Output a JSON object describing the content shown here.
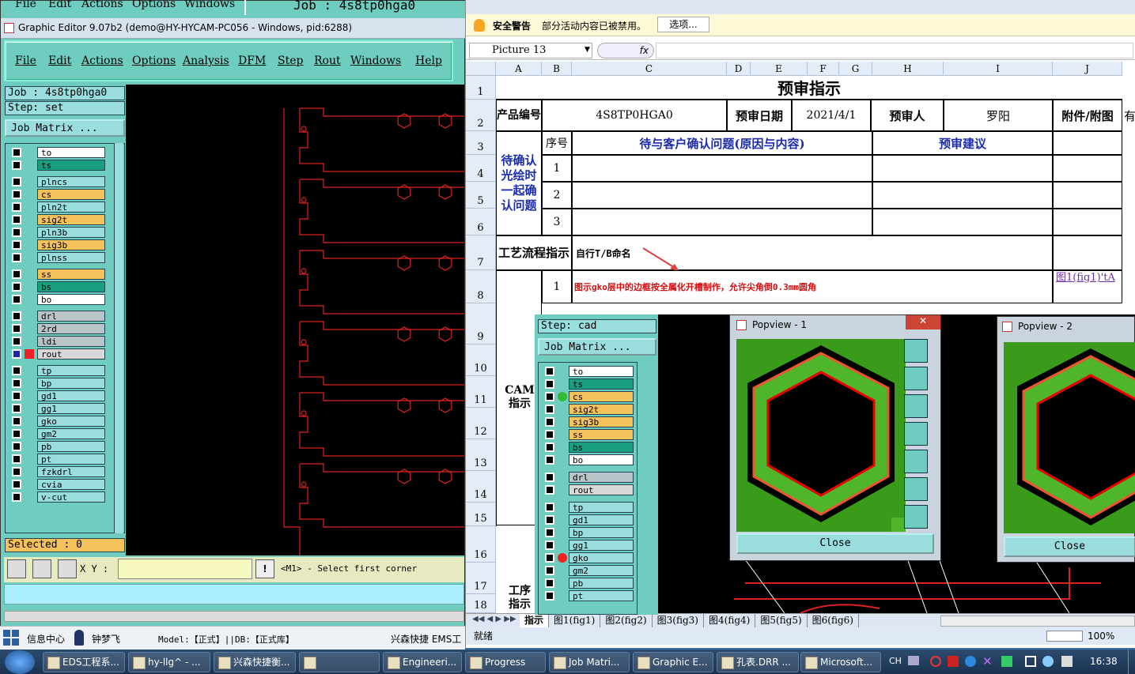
{
  "genesis": {
    "top_menu": [
      "File",
      "Edit",
      "Actions",
      "Options",
      "Windows"
    ],
    "top_job": "Job : 4s8tp0hga0",
    "title": "Graphic Editor 9.07b2 (demo@HY-HYCAM-PC056 - Windows, pid:6288)",
    "menu": [
      "File",
      "Edit",
      "Actions",
      "Options",
      "Analysis",
      "DFM",
      "Step",
      "Rout",
      "Windows",
      "Help"
    ],
    "job_label": "Job : 4s8tp0hga0",
    "step_label": "Step: set",
    "job_matrix": "Job Matrix ...",
    "layers": [
      {
        "name": "to",
        "color": "#ffffff"
      },
      {
        "name": "ts",
        "color": "#1a9e80"
      },
      {
        "name": "plncs",
        "color": "#9dd"
      },
      {
        "name": "cs",
        "color": "#f5c15a"
      },
      {
        "name": "pln2t",
        "color": "#9dd"
      },
      {
        "name": "sig2t",
        "color": "#f5c15a"
      },
      {
        "name": "pln3b",
        "color": "#9dd"
      },
      {
        "name": "sig3b",
        "color": "#f5c15a"
      },
      {
        "name": "plnss",
        "color": "#9dd"
      },
      {
        "name": "ss",
        "color": "#f5c15a"
      },
      {
        "name": "bs",
        "color": "#1a9e80"
      },
      {
        "name": "bo",
        "color": "#ffffff"
      },
      {
        "name": "drl",
        "color": "#b8c4c8"
      },
      {
        "name": "2rd",
        "color": "#b8c4c8"
      },
      {
        "name": "ldi",
        "color": "#b8c4c8"
      },
      {
        "name": "rout",
        "color": "#d8d8d8"
      },
      {
        "name": "tp",
        "color": "#9dd"
      },
      {
        "name": "bp",
        "color": "#9dd"
      },
      {
        "name": "gd1",
        "color": "#9dd"
      },
      {
        "name": "gg1",
        "color": "#9dd"
      },
      {
        "name": "gko",
        "color": "#9dd"
      },
      {
        "name": "gm2",
        "color": "#9dd"
      },
      {
        "name": "pb",
        "color": "#9dd"
      },
      {
        "name": "pt",
        "color": "#9dd"
      },
      {
        "name": "fzkdrl",
        "color": "#9dd"
      },
      {
        "name": "cvia",
        "color": "#9dd"
      },
      {
        "name": "v-cut",
        "color": "#9dd"
      }
    ],
    "selected": "Selected : 0",
    "xy_label": "X Y :",
    "prompt": "<M1> - Select first corner"
  },
  "excel": {
    "security_warning": "安全警告",
    "security_msg": "部分活动内容已被禁用。",
    "options_btn": "选项...",
    "name_box": "Picture 13",
    "fx": "fx",
    "columns": [
      "A",
      "B",
      "C",
      "D",
      "E",
      "F",
      "G",
      "H",
      "I",
      "J"
    ],
    "rows": [
      "1",
      "2",
      "3",
      "4",
      "5",
      "6",
      "7",
      "8",
      "9",
      "10",
      "11",
      "12",
      "13",
      "14",
      "15",
      "16",
      "17",
      "18"
    ],
    "title": "预审指示",
    "r2": {
      "product": "产品编号",
      "code": "4S8TP0HGA0",
      "date_label": "预审日期",
      "date": "2021/4/1",
      "reviewer_label": "预审人",
      "reviewer": "罗阳",
      "attach": "附件/附图",
      "extra": "有"
    },
    "r3": {
      "seq": "序号",
      "issue": "待与客户确认问题(原因与内容)",
      "suggest": "预审建议"
    },
    "side_confirm": "待确认光绘时一起确认问题",
    "nums": [
      "1",
      "2",
      "3"
    ],
    "process_label": "工艺流程指示",
    "process_text": "自行T/B命名",
    "r8_num": "1",
    "r8_text": "图示gko层中的边框按全属化开槽制作，允许尖角倒0.3mm圆角",
    "r8_link": "图1(fig1)'tA",
    "cam_label": "CAM指示",
    "proc_label": "工序指示",
    "sheet_tabs": [
      "指示",
      "图1(fig1)",
      "图2(fig2)",
      "图3(fig3)",
      "图4(fig4)",
      "图5(fig5)",
      "图6(fig6)"
    ],
    "status": "就绪",
    "zoom": "100%"
  },
  "overlay": {
    "step": "Step: cad",
    "job_matrix": "Job Matrix ...",
    "layers": [
      {
        "name": "to",
        "color": "#ffffff"
      },
      {
        "name": "ts",
        "color": "#1a9e80"
      },
      {
        "name": "cs",
        "color": "#f5c15a"
      },
      {
        "name": "sig2t",
        "color": "#f5c15a"
      },
      {
        "name": "sig3b",
        "color": "#f5c15a"
      },
      {
        "name": "ss",
        "color": "#f5c15a"
      },
      {
        "name": "bs",
        "color": "#1a9e80"
      },
      {
        "name": "bo",
        "color": "#ffffff"
      },
      {
        "name": "drl",
        "color": "#b8c4c8"
      },
      {
        "name": "rout",
        "color": "#d8d8d8"
      },
      {
        "name": "tp",
        "color": "#9dd"
      },
      {
        "name": "gd1",
        "color": "#9dd"
      },
      {
        "name": "bp",
        "color": "#9dd"
      },
      {
        "name": "gg1",
        "color": "#9dd"
      },
      {
        "name": "gko",
        "color": "#9dd"
      },
      {
        "name": "gm2",
        "color": "#9dd"
      },
      {
        "name": "pb",
        "color": "#9dd"
      },
      {
        "name": "pt",
        "color": "#9dd"
      }
    ],
    "popview1": "Popview - 1",
    "popview2": "Popview - 2",
    "close": "Close"
  },
  "bottom_bar": {
    "info_center": "信息中心",
    "user": "钟梦飞",
    "model": "Model:【正式】||DB:【正式库】",
    "company": "兴森快捷 EMS工"
  },
  "taskbar": {
    "items": [
      "EDS工程系...",
      "hy-llg^ - ...",
      "兴森快捷衡...",
      "",
      "Engineeri...",
      "Progress",
      "Job Matri...",
      "Graphic E...",
      "孔表.DRR ...",
      "Microsoft..."
    ],
    "lang": "CH",
    "clock": "16:38"
  }
}
